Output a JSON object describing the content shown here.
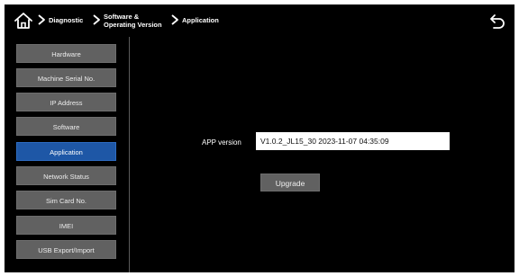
{
  "header": {
    "breadcrumbs": [
      "Diagnostic",
      "Software &\nOperating Version",
      "Application"
    ],
    "home_icon": "home-icon",
    "back_icon": "back-arrow-icon"
  },
  "sidebar": {
    "items": [
      {
        "label": "Hardware"
      },
      {
        "label": "Machine Serial No."
      },
      {
        "label": "IP Address"
      },
      {
        "label": "Software"
      },
      {
        "label": "Application"
      },
      {
        "label": "Network Status"
      },
      {
        "label": "Sim Card No."
      },
      {
        "label": "IMEI"
      },
      {
        "label": "USB Export/Import"
      }
    ],
    "active_index": 4
  },
  "main": {
    "app_version_label": "APP version",
    "app_version_value": "V1.0.2_JL15_30 2023-11-07 04:35:09",
    "upgrade_label": "Upgrade"
  },
  "colors": {
    "background": "#000000",
    "button": "#616161",
    "active_button": "#1e57a6",
    "text": "#ffffff"
  }
}
